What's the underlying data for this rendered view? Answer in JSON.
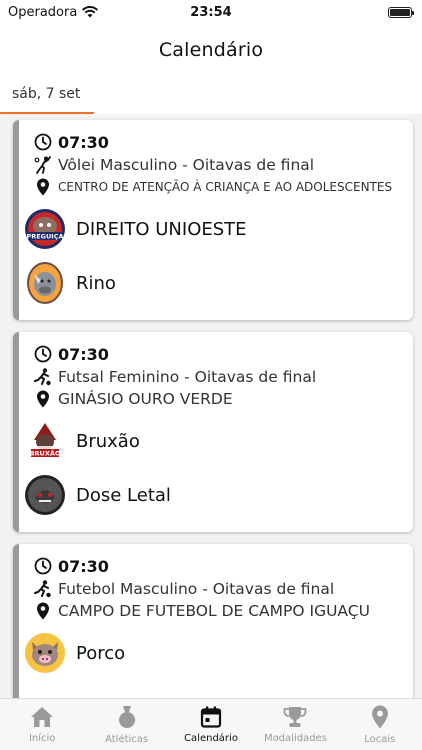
{
  "status": {
    "carrier": "Operadora",
    "time": "23:54"
  },
  "header": {
    "title": "Calendário"
  },
  "date_tab": {
    "label": "sáb, 7 set"
  },
  "games": [
    {
      "time": "07:30",
      "event": "Vôlei Masculino - Oitavas de final",
      "sport_icon": "volleyball-player-icon",
      "location": "Centro de atenção à criança e ao adolescentes",
      "teams": [
        {
          "name": "DIREITO UNIOESTE",
          "logo": "preguica-logo",
          "logo_text": "PREGUIÇA"
        },
        {
          "name": "Rino",
          "logo": "rino-logo",
          "logo_text": ""
        }
      ]
    },
    {
      "time": "07:30",
      "event": "Futsal Feminino - Oitavas de final",
      "sport_icon": "soccer-player-icon",
      "location": "Ginásio Ouro Verde",
      "teams": [
        {
          "name": "Bruxão",
          "logo": "bruxao-logo",
          "logo_text": "BRUXÃO"
        },
        {
          "name": "Dose Letal",
          "logo": "dose-letal-logo",
          "logo_text": ""
        }
      ]
    },
    {
      "time": "07:30",
      "event": "Futebol Masculino - Oitavas de final",
      "sport_icon": "soccer-player-icon",
      "location": "Campo de Futebol de Campo Iguaçu",
      "teams": [
        {
          "name": "Porco",
          "logo": "porco-logo",
          "logo_text": ""
        }
      ]
    }
  ],
  "tabbar": {
    "items": [
      {
        "label": "Início",
        "icon": "home-icon",
        "active": false
      },
      {
        "label": "Atléticas",
        "icon": "medal-icon",
        "active": false
      },
      {
        "label": "Calendário",
        "icon": "calendar-icon",
        "active": true
      },
      {
        "label": "Modalidades",
        "icon": "trophy-icon",
        "active": false
      },
      {
        "label": "Locais",
        "icon": "map-pin-icon",
        "active": false
      }
    ]
  },
  "colors": {
    "accent": "#f0702a",
    "card_border": "#9a9a9a",
    "inactive": "#9a9a9a"
  }
}
